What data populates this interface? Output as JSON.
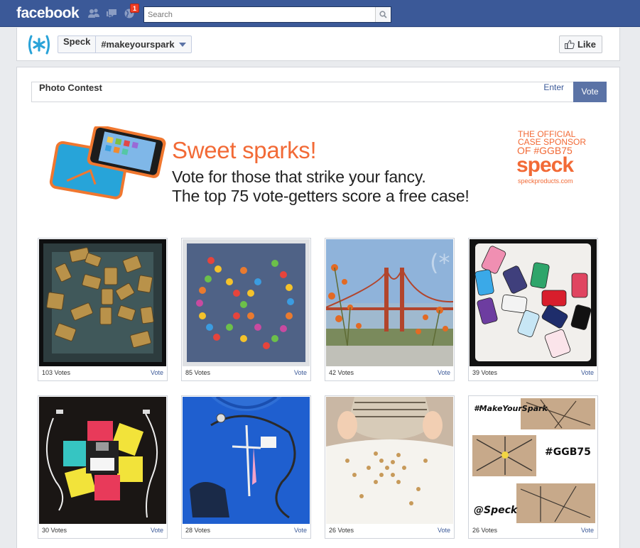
{
  "topbar": {
    "logo": "facebook",
    "notification_count": "1",
    "search_placeholder": "Search"
  },
  "page": {
    "name": "Speck",
    "tab_name": "#makeyourspark",
    "like_label": "Like"
  },
  "app": {
    "title": "Photo Contest",
    "tabs": [
      {
        "label": "Enter",
        "active": false
      },
      {
        "label": "Vote",
        "active": true
      }
    ]
  },
  "banner": {
    "headline": "Sweet sparks!",
    "line1": "Vote for those that strike your fancy.",
    "line2": "The top 75 vote-getters score a free case!",
    "sponsor_line1": "THE OFFICIAL",
    "sponsor_line2": "CASE SPONSOR",
    "sponsor_tag": "OF #GGB75",
    "sponsor_brand": "speck",
    "sponsor_url": "speckproducts.com"
  },
  "entries": [
    {
      "votes": "103 Votes",
      "vote_label": "Vote"
    },
    {
      "votes": "85 Votes",
      "vote_label": "Vote"
    },
    {
      "votes": "42 Votes",
      "vote_label": "Vote"
    },
    {
      "votes": "39 Votes",
      "vote_label": "Vote"
    },
    {
      "votes": "30 Votes",
      "vote_label": "Vote"
    },
    {
      "votes": "28 Votes",
      "vote_label": "Vote"
    },
    {
      "votes": "26 Votes",
      "vote_label": "Vote"
    },
    {
      "votes": "26 Votes",
      "vote_label": "Vote"
    }
  ],
  "photo_texts": {
    "collage_tag1": "#MakeYourSpark",
    "collage_tag2": "#GGB75",
    "collage_tag3": "@Speck"
  },
  "colors": {
    "facebook_blue": "#3b5998",
    "speck_orange": "#f26a36",
    "active_tab": "#5b73a6",
    "link": "#3b5998"
  }
}
